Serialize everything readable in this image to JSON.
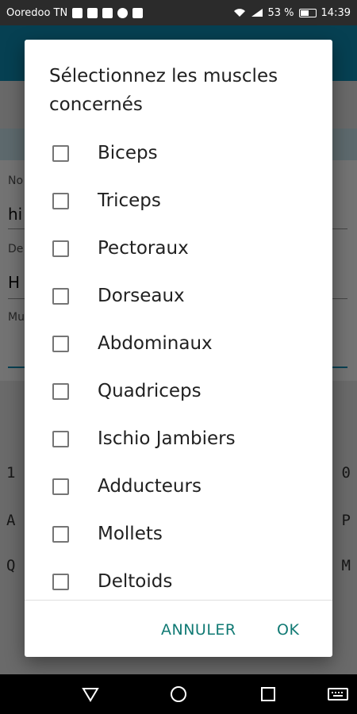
{
  "status_bar": {
    "carrier": "Ooredoo TN",
    "battery": "53 %",
    "time": "14:39",
    "notification_icons": [
      "facebook-icon",
      "facebook-icon",
      "sim-icon",
      "messenger-icon",
      "image-icon"
    ],
    "right_icons": [
      "wifi-icon",
      "signal-icon",
      "battery-icon"
    ]
  },
  "background": {
    "field1_label": "No",
    "field1_value": "hi",
    "field2_label": "De",
    "field2_value": "H",
    "field3_label": "Mu",
    "keyboard_row1": [
      "1",
      "0"
    ],
    "keyboard_row2": [
      "A",
      "P"
    ],
    "keyboard_row3": [
      "Q",
      "M"
    ]
  },
  "dialog": {
    "title": "Sélectionnez les muscles concernés",
    "options": [
      {
        "label": "Biceps",
        "checked": false
      },
      {
        "label": "Triceps",
        "checked": false
      },
      {
        "label": "Pectoraux",
        "checked": false
      },
      {
        "label": "Dorseaux",
        "checked": false
      },
      {
        "label": "Abdominaux",
        "checked": false
      },
      {
        "label": "Quadriceps",
        "checked": false
      },
      {
        "label": "Ischio Jambiers",
        "checked": false
      },
      {
        "label": "Adducteurs",
        "checked": false
      },
      {
        "label": "Mollets",
        "checked": false
      },
      {
        "label": "Deltoids",
        "checked": false
      }
    ],
    "cancel_label": "ANNULER",
    "ok_label": "OK",
    "accent_color": "#117a74"
  },
  "nav_bar": {
    "buttons": [
      "back-icon",
      "home-icon",
      "recents-icon",
      "keyboard-icon"
    ]
  }
}
